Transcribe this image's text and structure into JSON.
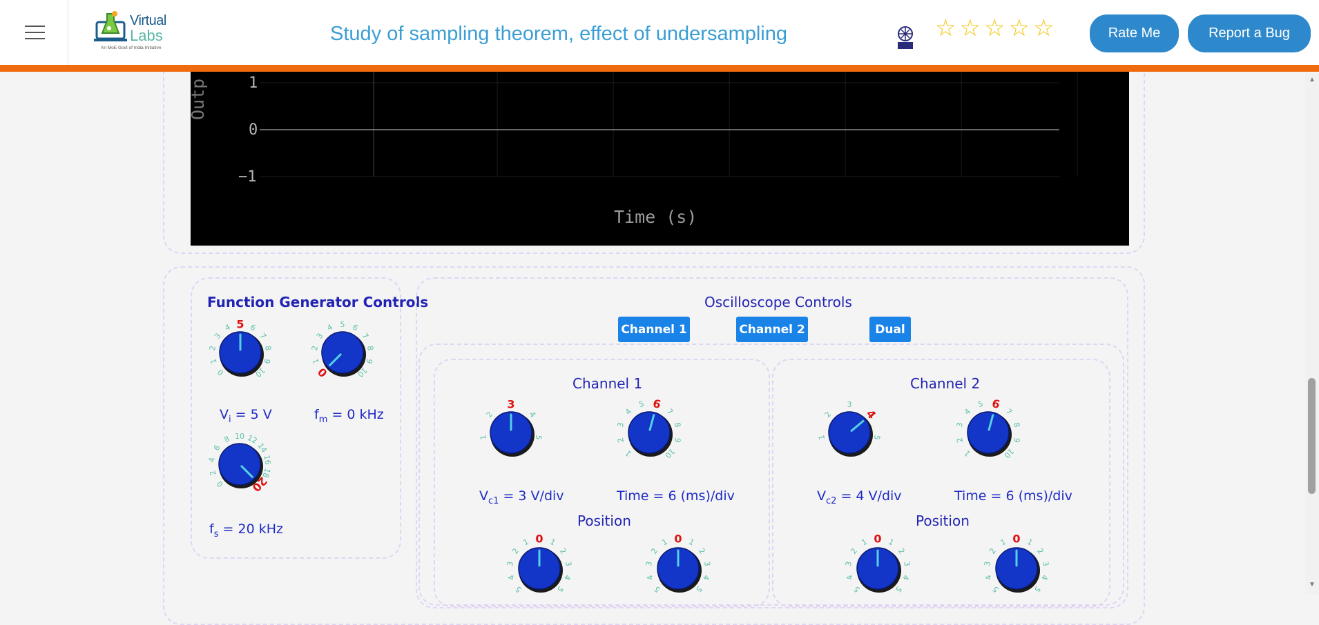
{
  "header": {
    "logo_line1": "Virtual",
    "logo_line2": "Labs",
    "logo_tagline": "An MoE Govt of India Initiative",
    "title": "Study of sampling theorem, effect of undersampling",
    "rate_label": "Rate Me",
    "bug_label": "Report a Bug",
    "star_count": 5,
    "star_color": "#f2c200",
    "accent": "#f06a0f"
  },
  "plot": {
    "ylabel": "Outp",
    "y_ticks": [
      "1",
      "0",
      "−1"
    ],
    "xlabel": "Time (s)"
  },
  "function_generator": {
    "title": "Function Generator Controls",
    "vi_knob": {
      "ticks": [
        "0",
        "1",
        "2",
        "3",
        "4",
        "5",
        "6",
        "7",
        "8",
        "9",
        "10"
      ],
      "value": "5"
    },
    "fm_knob": {
      "ticks": [
        "0",
        "1",
        "2",
        "3",
        "4",
        "5",
        "6",
        "7",
        "8",
        "9",
        "10"
      ],
      "value": "0"
    },
    "fs_knob": {
      "ticks": [
        "0",
        "2",
        "4",
        "6",
        "8",
        "10",
        "12",
        "14",
        "16",
        "18",
        "20"
      ],
      "value": "20"
    },
    "vi_symbol": "V",
    "vi_sub": "i",
    "vi_rest": " = 5 V",
    "fm_symbol": "f",
    "fm_sub": "m",
    "fm_rest": " = 0 kHz",
    "fs_symbol": "f",
    "fs_sub": "s",
    "fs_rest": " = 20 kHz"
  },
  "oscilloscope": {
    "title": "Oscilloscope Controls",
    "buttons": [
      "Channel 1",
      "Channel 2",
      "Dual"
    ],
    "channel1": {
      "title": "Channel 1",
      "volt_knob": {
        "ticks": [
          "1",
          "2",
          "3",
          "4",
          "5"
        ],
        "value": "3"
      },
      "time_knob": {
        "ticks": [
          "1",
          "2",
          "3",
          "4",
          "5",
          "6",
          "7",
          "8",
          "9",
          "10"
        ],
        "value": "6"
      },
      "volt_symbol": "V",
      "volt_sub": "c1",
      "volt_rest": " = 3 V/div",
      "time_readout": "Time = 6 (ms)/div",
      "position_title": "Position",
      "pos_knob_a": {
        "ticks": [
          "5",
          "4",
          "3",
          "2",
          "1",
          "0",
          "1",
          "2",
          "3",
          "4",
          "5"
        ],
        "value": "0"
      },
      "pos_knob_b": {
        "ticks": [
          "5",
          "4",
          "3",
          "2",
          "1",
          "0",
          "1",
          "2",
          "3",
          "4",
          "5"
        ],
        "value": "0"
      }
    },
    "channel2": {
      "title": "Channel 2",
      "volt_knob": {
        "ticks": [
          "1",
          "2",
          "3",
          "4",
          "5"
        ],
        "value": "4"
      },
      "time_knob": {
        "ticks": [
          "1",
          "2",
          "3",
          "4",
          "5",
          "6",
          "7",
          "8",
          "9",
          "10"
        ],
        "value": "6"
      },
      "volt_symbol": "V",
      "volt_sub": "c2",
      "volt_rest": " = 4 V/div",
      "time_readout": "Time = 6 (ms)/div",
      "position_title": "Position",
      "pos_knob_a": {
        "ticks": [
          "5",
          "4",
          "3",
          "2",
          "1",
          "0",
          "1",
          "2",
          "3",
          "4",
          "5"
        ],
        "value": "0"
      },
      "pos_knob_b": {
        "ticks": [
          "5",
          "4",
          "3",
          "2",
          "1",
          "0",
          "1",
          "2",
          "3",
          "4",
          "5"
        ],
        "value": "0"
      }
    }
  },
  "colors": {
    "knob_fill": "#1436c8",
    "knob_pointer": "#52d2e6",
    "tick_color": "#5fc0a8",
    "value_color": "#e01010",
    "label_blue": "#2223b3",
    "button_blue": "#1a83e8"
  }
}
